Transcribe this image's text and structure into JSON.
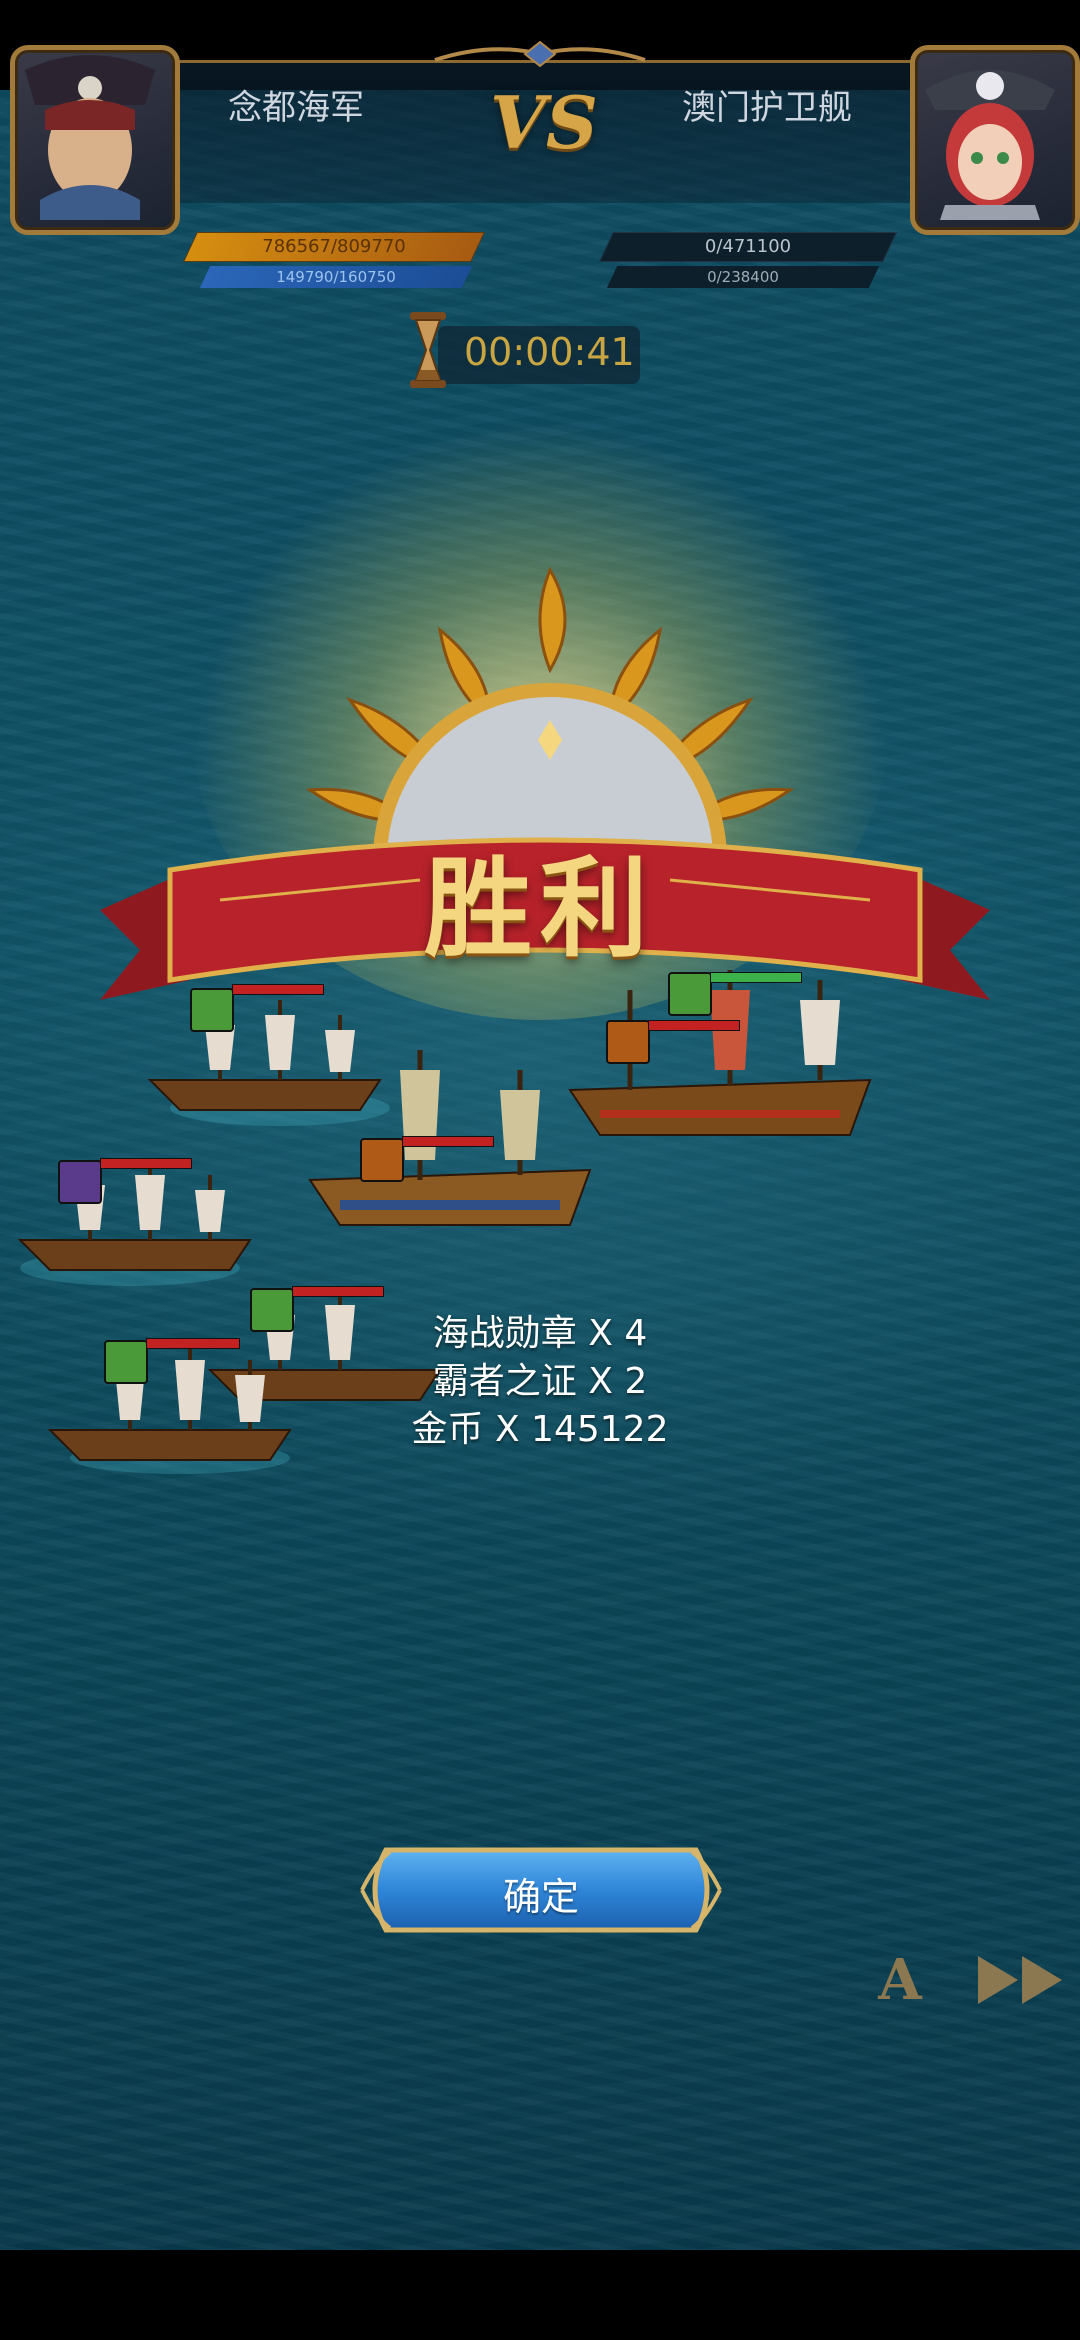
{
  "header": {
    "left_name": "念都海军",
    "right_name": "澳门护卫舰",
    "vs_label": "VS",
    "left_hp": "786567/809770",
    "left_hp_fraction": 0.971,
    "left_mp": "149790/160750",
    "left_mp_fraction": 0.932,
    "right_hp": "0/471100",
    "right_hp_fraction": 0,
    "right_mp": "0/238400",
    "right_mp_fraction": 0
  },
  "timer": {
    "value": "00:00:41"
  },
  "result": {
    "title": "胜利"
  },
  "rewards": [
    {
      "text": "海战勋章 X 4"
    },
    {
      "text": "霸者之证 X 2"
    },
    {
      "text": "金币 X 145122"
    }
  ],
  "controls": {
    "confirm_label": "确定",
    "auto_label": "A"
  },
  "colors": {
    "gold": "#d6a548",
    "banner_red": "#b8222a",
    "sea": "#0f5266",
    "confirm_blue": "#2f86d8"
  },
  "icons": {
    "hourglass": "hourglass-icon",
    "fast_forward": "fast-forward-icon",
    "repair": "repair-icon"
  }
}
